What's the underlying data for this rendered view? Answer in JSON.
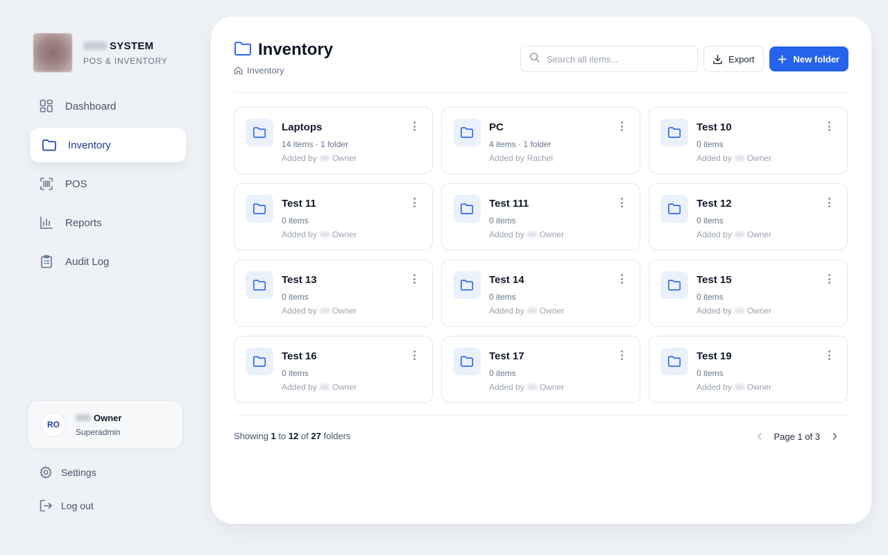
{
  "brand": {
    "title": "SYSTEM",
    "subtitle": "POS & INVENTORY"
  },
  "nav": [
    {
      "label": "Dashboard",
      "icon": "dashboard-grid-icon",
      "active": false
    },
    {
      "label": "Inventory",
      "icon": "folder-icon",
      "active": true
    },
    {
      "label": "POS",
      "icon": "barcode-scan-icon",
      "active": false
    },
    {
      "label": "Reports",
      "icon": "bar-chart-icon",
      "active": false
    },
    {
      "label": "Audit Log",
      "icon": "clipboard-list-icon",
      "active": false
    }
  ],
  "user": {
    "initials": "RO",
    "name": "Owner",
    "role": "Superadmin"
  },
  "bottom_links": {
    "settings": "Settings",
    "logout": "Log out"
  },
  "header": {
    "title": "Inventory",
    "breadcrumb": "Inventory"
  },
  "toolbar": {
    "search_placeholder": "Search all items...",
    "export_label": "Export",
    "new_folder_label": "New folder"
  },
  "folders": [
    {
      "name": "Laptops",
      "meta": "14 items · 1 folder",
      "added_prefix": "Added by",
      "added_by": "Owner",
      "redacted": true
    },
    {
      "name": "PC",
      "meta": "4 items · 1 folder",
      "added_prefix": "Added by",
      "added_by": "Rachel",
      "redacted": false
    },
    {
      "name": "Test 10",
      "meta": "0 items",
      "added_prefix": "Added by",
      "added_by": "Owner",
      "redacted": true
    },
    {
      "name": "Test 11",
      "meta": "0 items",
      "added_prefix": "Added by",
      "added_by": "Owner",
      "redacted": true
    },
    {
      "name": "Test 111",
      "meta": "0 items",
      "added_prefix": "Added by",
      "added_by": "Owner",
      "redacted": true
    },
    {
      "name": "Test 12",
      "meta": "0 items",
      "added_prefix": "Added by",
      "added_by": "Owner",
      "redacted": true
    },
    {
      "name": "Test 13",
      "meta": "0 items",
      "added_prefix": "Added by",
      "added_by": "Owner",
      "redacted": true
    },
    {
      "name": "Test 14",
      "meta": "0 items",
      "added_prefix": "Added by",
      "added_by": "Owner",
      "redacted": true
    },
    {
      "name": "Test 15",
      "meta": "0 items",
      "added_prefix": "Added by",
      "added_by": "Owner",
      "redacted": true
    },
    {
      "name": "Test 16",
      "meta": "0 items",
      "added_prefix": "Added by",
      "added_by": "Owner",
      "redacted": true
    },
    {
      "name": "Test 17",
      "meta": "0 items",
      "added_prefix": "Added by",
      "added_by": "Owner",
      "redacted": true
    },
    {
      "name": "Test 19",
      "meta": "0 items",
      "added_prefix": "Added by",
      "added_by": "Owner",
      "redacted": true
    }
  ],
  "pagination": {
    "showing_prefix": "Showing",
    "from": "1",
    "to_word": "to",
    "to": "12",
    "of_word": "of",
    "total": "27",
    "suffix": "folders",
    "page_label": "Page 1 of 3"
  },
  "colors": {
    "accent": "#2563eb",
    "active_nav_text": "#1e3a8a",
    "background": "#eef1f5",
    "folder_icon": "#2563eb"
  }
}
